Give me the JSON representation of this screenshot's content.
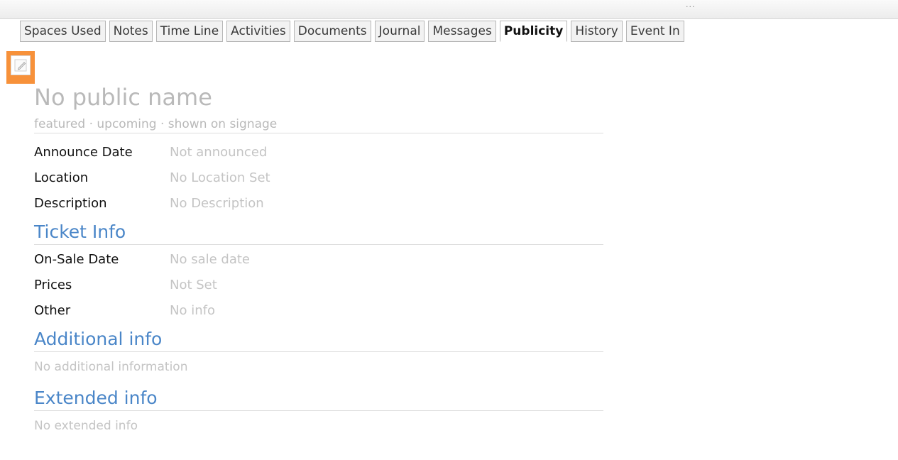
{
  "tabs": [
    "Spaces Used",
    "Notes",
    "Time Line",
    "Activities",
    "Documents",
    "Journal",
    "Messages",
    "Publicity",
    "History",
    "Event In"
  ],
  "active_tab": "Publicity",
  "toolbar": {
    "grip": "..."
  },
  "publicity": {
    "public_name": "No public name",
    "flags": "featured · upcoming · shown on signage",
    "announce_label": "Announce Date",
    "announce_value": "Not announced",
    "location_label": "Location",
    "location_value": "No Location Set",
    "description_label": "Description",
    "description_value": "No Description"
  },
  "ticket": {
    "title": "Ticket Info",
    "onsale_label": "On-Sale Date",
    "onsale_value": "No sale date",
    "prices_label": "Prices",
    "prices_value": "Not Set",
    "other_label": "Other",
    "other_value": "No info"
  },
  "additional": {
    "title": "Additional info",
    "value": "No additional information"
  },
  "extended": {
    "title": "Extended info",
    "value": "No extended info"
  },
  "colors": {
    "accent": "#4a86c8",
    "edit_highlight": "#f7913a",
    "muted_text": "#c4c4c4"
  },
  "icons": {
    "edit": "pencil-icon"
  }
}
